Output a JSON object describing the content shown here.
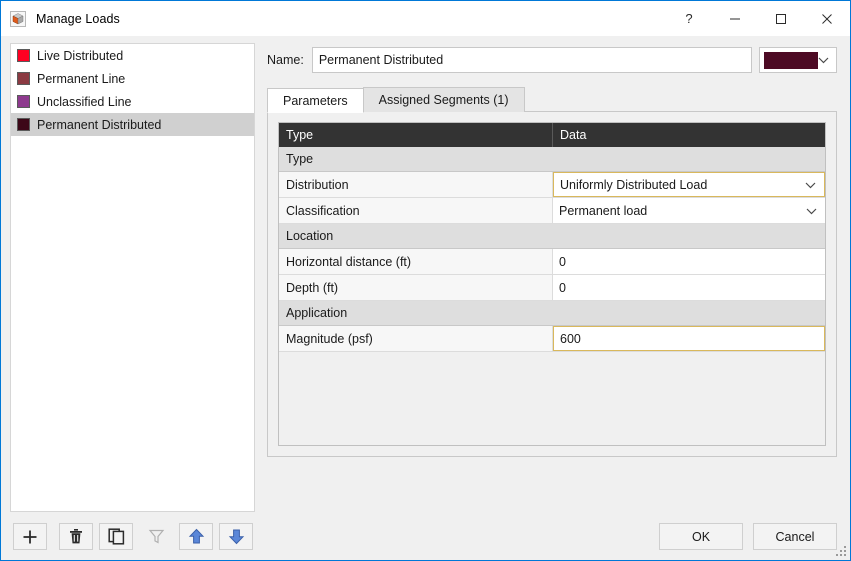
{
  "window": {
    "title": "Manage Loads",
    "app_icon": "cube-icon",
    "controls": {
      "help": "?",
      "minimize": "–",
      "maximize": "□",
      "close": "✕"
    }
  },
  "list_panel": {
    "items": [
      {
        "label": "Live Distributed",
        "color": "#ff0022",
        "selected": false
      },
      {
        "label": "Permanent Line",
        "color": "#8b3a42",
        "selected": false
      },
      {
        "label": "Unclassified Line",
        "color": "#8e3a8e",
        "selected": false
      },
      {
        "label": "Permanent Distributed",
        "color": "#3d0818",
        "selected": true
      }
    ]
  },
  "name_row": {
    "label": "Name:",
    "value": "Permanent Distributed",
    "placeholder": "",
    "color_value": "#4d0a24"
  },
  "tabs": [
    {
      "label": "Parameters",
      "active": true
    },
    {
      "label": "Assigned Segments (1)",
      "active": false
    }
  ],
  "grid": {
    "headers": {
      "type": "Type",
      "data": "Data"
    },
    "rows": [
      {
        "kind": "group",
        "label": "Type"
      },
      {
        "kind": "row",
        "label": "Distribution",
        "value": "Uniformly Distributed Load",
        "control": "dropdown",
        "highlight": true
      },
      {
        "kind": "row",
        "label": "Classification",
        "value": "Permanent load",
        "control": "dropdown",
        "highlight": false
      },
      {
        "kind": "group",
        "label": "Location"
      },
      {
        "kind": "row",
        "label": "Horizontal distance (ft)",
        "value": "0",
        "control": "text",
        "highlight": false
      },
      {
        "kind": "row",
        "label": "Depth (ft)",
        "value": "0",
        "control": "text",
        "highlight": false
      },
      {
        "kind": "group",
        "label": "Application"
      },
      {
        "kind": "row",
        "label": "Magnitude (psf)",
        "value": "600",
        "control": "text",
        "highlight": true
      }
    ]
  },
  "toolbar": {
    "buttons": [
      {
        "name": "add-button",
        "icon": "plus-icon",
        "enabled": true,
        "title": "Add"
      },
      {
        "name": "delete-button",
        "icon": "trash-icon",
        "enabled": true,
        "title": "Delete"
      },
      {
        "name": "duplicate-button",
        "icon": "copy-icon",
        "enabled": true,
        "title": "Duplicate"
      },
      {
        "name": "filter-button",
        "icon": "filter-icon",
        "enabled": false,
        "title": "Filter"
      },
      {
        "name": "move-up-button",
        "icon": "arrow-up-icon",
        "enabled": true,
        "title": "Move up"
      },
      {
        "name": "move-down-button",
        "icon": "arrow-down-icon",
        "enabled": true,
        "title": "Move down"
      }
    ]
  },
  "dialog_buttons": {
    "ok": "OK",
    "cancel": "Cancel"
  },
  "colors": {
    "accent": "#0078d7",
    "header_bg": "#333333",
    "highlight_border": "#d9b85c",
    "selection_bg": "#d0d0d0",
    "arrow_blue": "#5b87d8"
  }
}
